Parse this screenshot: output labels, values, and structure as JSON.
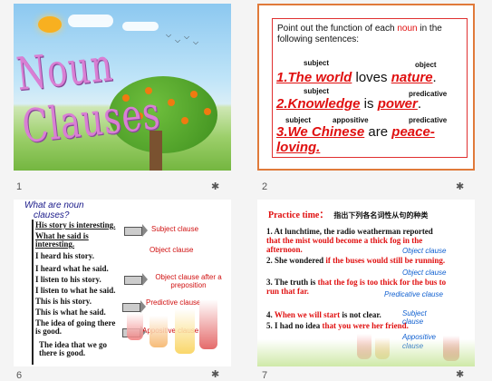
{
  "slides": [
    {
      "number": "1",
      "star": "✱",
      "title": "Noun Clauses"
    },
    {
      "number": "2",
      "star": "✱",
      "prompt_a": "Point out the function of each ",
      "prompt_kw": "noun",
      "prompt_b": " in the following sentences:",
      "labels": {
        "subject1": "subject",
        "object1": "object",
        "subject2": "subject",
        "predicative": "predicative",
        "subject3": "subject",
        "appositive": "appositive",
        "predicative2": "predicative"
      },
      "s1_a": "1.The world",
      "s1_b": " loves ",
      "s1_c": "nature",
      "s2_a": "2.Knowledge",
      "s2_b": " is ",
      "s2_c": "power",
      "s3_a": "3.We Chinese",
      "s3_b": " are ",
      "s3_c": "peace-loving."
    },
    {
      "number": "6",
      "star": "✱",
      "heading_1": "What are noun",
      "heading_2": "clauses?",
      "sentences": [
        "His story is interesting.",
        "What he said is interesting.",
        "I heard his story.",
        "I heard what he said.",
        "I listen to his story.",
        "I listen to what he said.",
        "This is his story.",
        "This is what he said.",
        "The idea of going there is good.",
        "The idea that we go there is good."
      ],
      "clause_labels": [
        "Subject clause",
        "Object clause",
        "Object clause after a preposition",
        "Predictive clause",
        "Appositive clause"
      ]
    },
    {
      "number": "7",
      "star": "✱",
      "title": "Practice time：",
      "title_cn": "指出下列各名词性从句的种类",
      "items": [
        {
          "a": "1.  At lunchtime, the radio weatherman reported ",
          "b": "that the mist would become a thick fog in the afternoon."
        },
        {
          "a": "2. She wondered ",
          "b": "if the buses would still be running."
        },
        {
          "a": "3. The truth is ",
          "b": "that the fog is too thick for the bus to run that far."
        },
        {
          "a": "4. ",
          "b": "When we will start",
          "c": " is not clear."
        },
        {
          "a": "5. I had no idea ",
          "b": "that you were her friend."
        }
      ],
      "tags": [
        "Object clause",
        "Object clause",
        "Predicative clause",
        "Subject clause",
        "Appositive clause"
      ]
    }
  ]
}
